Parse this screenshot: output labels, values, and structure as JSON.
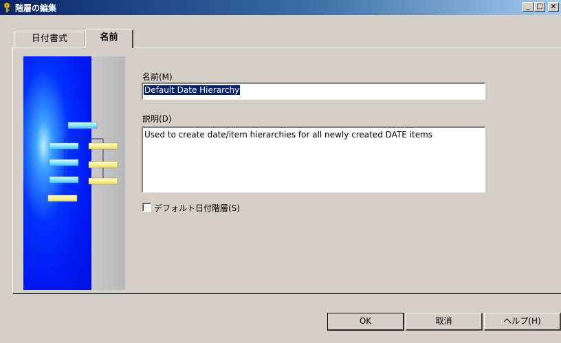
{
  "window": {
    "title": "階層の編集",
    "minimize": "_",
    "maximize": "□",
    "close": "×"
  },
  "tabs": [
    {
      "label": "日付書式",
      "active": false
    },
    {
      "label": "名前",
      "active": true
    }
  ],
  "form": {
    "name_label": "名前(M)",
    "name_value": "Default Date Hierarchy",
    "description_label": "説明(D)",
    "description_value": "Used to create date/item hierarchies for all newly created DATE items",
    "default_checkbox_label": "デフォルト日付階層(S)",
    "default_checked": false
  },
  "buttons": {
    "ok": "OK",
    "cancel": "取消",
    "help": "ヘルプ(H)"
  },
  "icons": {
    "app": "key-icon",
    "illustration": "hierarchy-diagram-icon"
  }
}
